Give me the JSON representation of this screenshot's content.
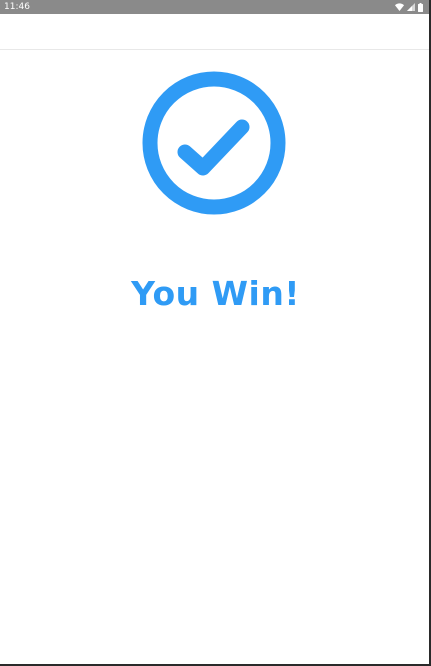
{
  "status_bar": {
    "time": "11:46",
    "icons": [
      "wifi-icon",
      "cellular-signal-icon",
      "battery-icon"
    ]
  },
  "result": {
    "icon": "check-circle-icon",
    "title": "You Win!"
  },
  "colors": {
    "accent": "#2f9bf5",
    "status_bar": "#8a8a8a",
    "background": "#ffffff"
  }
}
